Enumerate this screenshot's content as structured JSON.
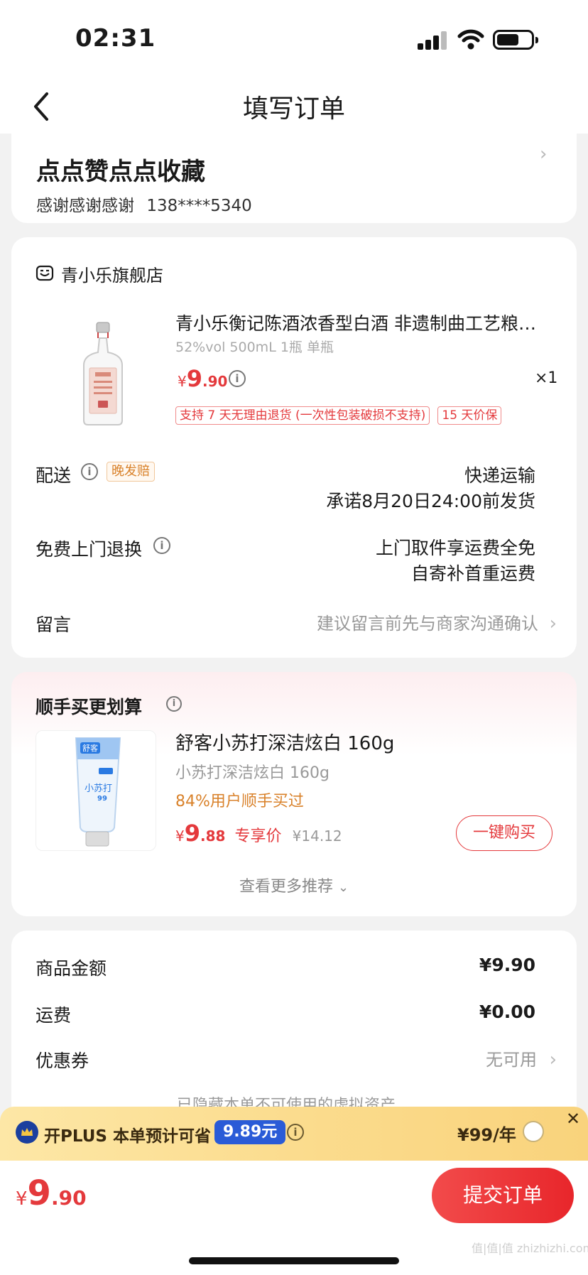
{
  "status_bar": {
    "time": "02:31"
  },
  "nav": {
    "title": "填写订单"
  },
  "address": {
    "name": "点点赞点点收藏",
    "contact": "感谢感谢感谢",
    "phone": "138****5340"
  },
  "shop": {
    "name": "青小乐旗舰店",
    "product": {
      "title": "青小乐衡记陈酒浓香型白酒 非遗制曲工艺粮…",
      "spec": "52%vol 500mL 1瓶 单瓶",
      "price_symbol": "¥",
      "price_int": "9",
      "price_dec": ".90",
      "quantity": "×1",
      "tags": [
        "支持 7 天无理由退货 (一次性包装破损不支持)",
        "15 天价保"
      ]
    },
    "delivery": {
      "label": "配送",
      "badge": "晚发赔",
      "method": "快递运输",
      "promise": "承诺8月20日24:00前发货"
    },
    "return_service": {
      "label": "免费上门退换",
      "line1": "上门取件享运费全免",
      "line2": "自寄补首重运费"
    },
    "message": {
      "label": "留言",
      "placeholder": "建议留言前先与商家沟通确认"
    }
  },
  "recommend": {
    "title": "顺手买更划算",
    "item": {
      "title": "舒客小苏打深洁炫白 160g",
      "spec": "小苏打深洁炫白 160g",
      "bought": "84%用户顺手买过",
      "price_symbol": "¥",
      "price_int": "9",
      "price_dec": ".88",
      "price_tag": "专享价",
      "orig_price": "¥14.12",
      "buy_button": "一键购买",
      "pack_brand": "舒客",
      "pack_name": "小苏打",
      "pack_badge": "99"
    },
    "more": "查看更多推荐"
  },
  "summary": {
    "rows": [
      {
        "label": "商品金额",
        "value": "¥9.90"
      },
      {
        "label": "运费",
        "value": "¥0.00"
      },
      {
        "label": "优惠券",
        "value": "无可用"
      }
    ],
    "hidden_note": "已隐藏本单不可使用的虚拟资产"
  },
  "plus": {
    "text": "开PLUS 本单预计可省",
    "save": "9.89元",
    "price": "¥99/年"
  },
  "bottom": {
    "total_symbol": "¥",
    "total_int": "9",
    "total_dec": ".90",
    "submit": "提交订单"
  },
  "watermark": "值|值|值 zhizhizhi.com",
  "colors": {
    "accent": "#e4393c",
    "plus_gold": "#fbdc8e",
    "plus_badge": "#2a5bd7"
  }
}
